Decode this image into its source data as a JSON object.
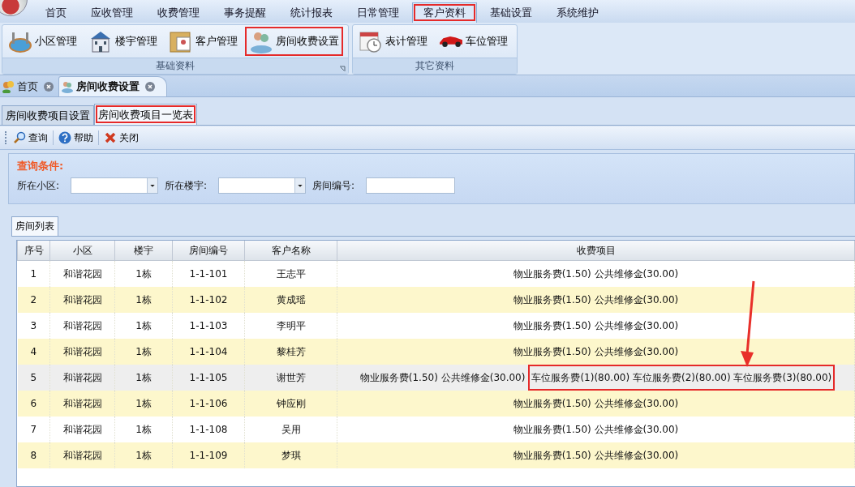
{
  "menu": [
    {
      "label": "首页",
      "selected": false,
      "highlighted": false
    },
    {
      "label": "应收管理",
      "selected": false,
      "highlighted": false
    },
    {
      "label": "收费管理",
      "selected": false,
      "highlighted": false
    },
    {
      "label": "事务提醒",
      "selected": false,
      "highlighted": false
    },
    {
      "label": "统计报表",
      "selected": false,
      "highlighted": false
    },
    {
      "label": "日常管理",
      "selected": false,
      "highlighted": false
    },
    {
      "label": "客户资料",
      "selected": true,
      "highlighted": true
    },
    {
      "label": "基础设置",
      "selected": false,
      "highlighted": false
    },
    {
      "label": "系统维护",
      "selected": false,
      "highlighted": false
    }
  ],
  "ribbon_groups": [
    {
      "title": "基础资料",
      "launcher": true,
      "buttons": [
        {
          "label": "小区管理",
          "highlighted": false
        },
        {
          "label": "楼宇管理",
          "highlighted": false
        },
        {
          "label": "客户管理",
          "highlighted": false
        },
        {
          "label": "房间收费设置",
          "highlighted": true
        }
      ]
    },
    {
      "title": "其它资料",
      "launcher": false,
      "buttons": [
        {
          "label": "表计管理",
          "highlighted": false
        },
        {
          "label": "车位管理",
          "highlighted": false
        }
      ]
    }
  ],
  "doc_tabs": [
    {
      "label": "首页",
      "selected": false
    },
    {
      "label": "房间收费设置",
      "selected": true
    }
  ],
  "sub_tabs": [
    {
      "label": "房间收费项目设置",
      "selected": false,
      "highlighted": false
    },
    {
      "label": "房间收费项目一览表",
      "selected": true,
      "highlighted": true
    }
  ],
  "toolbar": [
    {
      "label": "查询"
    },
    {
      "label": "帮助"
    },
    {
      "label": "关闭"
    }
  ],
  "query": {
    "title": "查询条件:",
    "fields": [
      {
        "label": "所在小区:",
        "kind": "combo"
      },
      {
        "label": "所在楼宇:",
        "kind": "combo"
      },
      {
        "label": "房间编号:",
        "kind": "text"
      }
    ]
  },
  "list_tab": {
    "label": "房间列表"
  },
  "table": {
    "columns": [
      "序号",
      "小区",
      "楼宇",
      "房间编号",
      "客户名称",
      "收费项目"
    ],
    "rows": [
      {
        "cells": [
          "1",
          "和谐花园",
          "1栋",
          "1-1-101",
          "王志平"
        ],
        "selected": false,
        "fees": [
          {
            "text": "物业服务费(1.50) 公共维修金(30.00)",
            "highlighted": false
          }
        ]
      },
      {
        "cells": [
          "2",
          "和谐花园",
          "1栋",
          "1-1-102",
          "黄成瑶"
        ],
        "selected": false,
        "fees": [
          {
            "text": "物业服务费(1.50) 公共维修金(30.00)",
            "highlighted": false
          }
        ]
      },
      {
        "cells": [
          "3",
          "和谐花园",
          "1栋",
          "1-1-103",
          "李明平"
        ],
        "selected": false,
        "fees": [
          {
            "text": "物业服务费(1.50) 公共维修金(30.00)",
            "highlighted": false
          }
        ]
      },
      {
        "cells": [
          "4",
          "和谐花园",
          "1栋",
          "1-1-104",
          "黎桂芳"
        ],
        "selected": false,
        "fees": [
          {
            "text": "物业服务费(1.50) 公共维修金(30.00)",
            "highlighted": false
          }
        ]
      },
      {
        "cells": [
          "5",
          "和谐花园",
          "1栋",
          "1-1-105",
          "谢世芳"
        ],
        "selected": true,
        "fees": [
          {
            "text": "物业服务费(1.50) 公共维修金(30.00)",
            "highlighted": false
          },
          {
            "text": "车位服务费(1)(80.00) 车位服务费(2)(80.00) 车位服务费(3)(80.00)",
            "highlighted": true
          }
        ]
      },
      {
        "cells": [
          "6",
          "和谐花园",
          "1栋",
          "1-1-106",
          "钟应刚"
        ],
        "selected": false,
        "fees": [
          {
            "text": "物业服务费(1.50) 公共维修金(30.00)",
            "highlighted": false
          }
        ]
      },
      {
        "cells": [
          "7",
          "和谐花园",
          "1栋",
          "1-1-108",
          "吴用"
        ],
        "selected": false,
        "fees": [
          {
            "text": "物业服务费(1.50) 公共维修金(30.00)",
            "highlighted": false
          }
        ]
      },
      {
        "cells": [
          "8",
          "和谐花园",
          "1栋",
          "1-1-109",
          "梦琪"
        ],
        "selected": false,
        "fees": [
          {
            "text": "物业服务费(1.50) 公共维修金(30.00)",
            "highlighted": false
          }
        ]
      }
    ]
  },
  "annotation_arrow": true
}
